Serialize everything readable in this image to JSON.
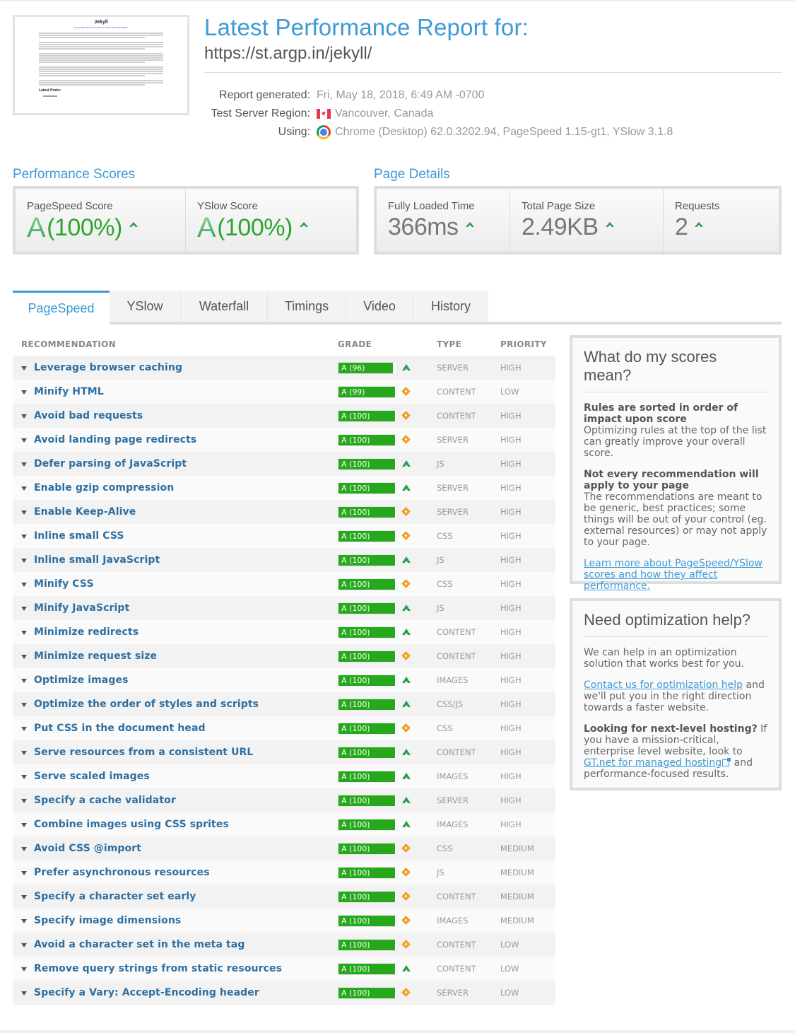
{
  "header": {
    "title": "Latest Performance Report for:",
    "url": "https://st.argp.in/jekyll/",
    "thumbnail": {
      "site_title": "Jekyll",
      "nav": "Home Blog Source Download Gem Documentation",
      "section": "Latest Posts:"
    },
    "meta": [
      {
        "label": "Report generated:",
        "value": "Fri, May 18, 2018, 6:49 AM -0700",
        "icon": ""
      },
      {
        "label": "Test Server Region:",
        "value": "Vancouver, Canada",
        "icon": "canada-flag-icon"
      },
      {
        "label": "Using:",
        "value": "Chrome (Desktop) 62.0.3202.94, PageSpeed 1.15-gt1, YSlow 3.1.8",
        "icon": "chrome-icon"
      }
    ]
  },
  "performance_scores": {
    "heading": "Performance Scores",
    "items": [
      {
        "label": "PageSpeed Score",
        "grade": "A",
        "percent": "(100%)",
        "trend": "up"
      },
      {
        "label": "YSlow Score",
        "grade": "A",
        "percent": "(100%)",
        "trend": "up"
      }
    ]
  },
  "page_details": {
    "heading": "Page Details",
    "items": [
      {
        "label": "Fully Loaded Time",
        "value": "366ms",
        "trend": "up"
      },
      {
        "label": "Total Page Size",
        "value": "2.49KB",
        "trend": "up"
      },
      {
        "label": "Requests",
        "value": "2",
        "trend": "up"
      }
    ]
  },
  "tabs": [
    {
      "label": "PageSpeed",
      "active": true
    },
    {
      "label": "YSlow",
      "active": false
    },
    {
      "label": "Waterfall",
      "active": false
    },
    {
      "label": "Timings",
      "active": false
    },
    {
      "label": "Video",
      "active": false
    },
    {
      "label": "History",
      "active": false
    }
  ],
  "table": {
    "columns": {
      "recommendation": "RECOMMENDATION",
      "grade": "GRADE",
      "type": "TYPE",
      "priority": "PRIORITY"
    },
    "rows": [
      {
        "name": "Leverage browser caching",
        "grade": "A (96)",
        "score": 96,
        "trend": "up",
        "type": "SERVER",
        "priority": "HIGH"
      },
      {
        "name": "Minify HTML",
        "grade": "A (99)",
        "score": 99,
        "trend": "neutral",
        "type": "CONTENT",
        "priority": "LOW"
      },
      {
        "name": "Avoid bad requests",
        "grade": "A (100)",
        "score": 100,
        "trend": "neutral",
        "type": "CONTENT",
        "priority": "HIGH"
      },
      {
        "name": "Avoid landing page redirects",
        "grade": "A (100)",
        "score": 100,
        "trend": "neutral",
        "type": "SERVER",
        "priority": "HIGH"
      },
      {
        "name": "Defer parsing of JavaScript",
        "grade": "A (100)",
        "score": 100,
        "trend": "up",
        "type": "JS",
        "priority": "HIGH"
      },
      {
        "name": "Enable gzip compression",
        "grade": "A (100)",
        "score": 100,
        "trend": "up",
        "type": "SERVER",
        "priority": "HIGH"
      },
      {
        "name": "Enable Keep-Alive",
        "grade": "A (100)",
        "score": 100,
        "trend": "neutral",
        "type": "SERVER",
        "priority": "HIGH"
      },
      {
        "name": "Inline small CSS",
        "grade": "A (100)",
        "score": 100,
        "trend": "neutral",
        "type": "CSS",
        "priority": "HIGH"
      },
      {
        "name": "Inline small JavaScript",
        "grade": "A (100)",
        "score": 100,
        "trend": "up",
        "type": "JS",
        "priority": "HIGH"
      },
      {
        "name": "Minify CSS",
        "grade": "A (100)",
        "score": 100,
        "trend": "neutral",
        "type": "CSS",
        "priority": "HIGH"
      },
      {
        "name": "Minify JavaScript",
        "grade": "A (100)",
        "score": 100,
        "trend": "up",
        "type": "JS",
        "priority": "HIGH"
      },
      {
        "name": "Minimize redirects",
        "grade": "A (100)",
        "score": 100,
        "trend": "up",
        "type": "CONTENT",
        "priority": "HIGH"
      },
      {
        "name": "Minimize request size",
        "grade": "A (100)",
        "score": 100,
        "trend": "neutral",
        "type": "CONTENT",
        "priority": "HIGH"
      },
      {
        "name": "Optimize images",
        "grade": "A (100)",
        "score": 100,
        "trend": "up",
        "type": "IMAGES",
        "priority": "HIGH"
      },
      {
        "name": "Optimize the order of styles and scripts",
        "grade": "A (100)",
        "score": 100,
        "trend": "up",
        "type": "CSS/JS",
        "priority": "HIGH"
      },
      {
        "name": "Put CSS in the document head",
        "grade": "A (100)",
        "score": 100,
        "trend": "neutral",
        "type": "CSS",
        "priority": "HIGH"
      },
      {
        "name": "Serve resources from a consistent URL",
        "grade": "A (100)",
        "score": 100,
        "trend": "up",
        "type": "CONTENT",
        "priority": "HIGH"
      },
      {
        "name": "Serve scaled images",
        "grade": "A (100)",
        "score": 100,
        "trend": "up",
        "type": "IMAGES",
        "priority": "HIGH"
      },
      {
        "name": "Specify a cache validator",
        "grade": "A (100)",
        "score": 100,
        "trend": "up",
        "type": "SERVER",
        "priority": "HIGH"
      },
      {
        "name": "Combine images using CSS sprites",
        "grade": "A (100)",
        "score": 100,
        "trend": "up",
        "type": "IMAGES",
        "priority": "HIGH"
      },
      {
        "name": "Avoid CSS @import",
        "grade": "A (100)",
        "score": 100,
        "trend": "neutral",
        "type": "CSS",
        "priority": "MEDIUM"
      },
      {
        "name": "Prefer asynchronous resources",
        "grade": "A (100)",
        "score": 100,
        "trend": "neutral",
        "type": "JS",
        "priority": "MEDIUM"
      },
      {
        "name": "Specify a character set early",
        "grade": "A (100)",
        "score": 100,
        "trend": "neutral",
        "type": "CONTENT",
        "priority": "MEDIUM"
      },
      {
        "name": "Specify image dimensions",
        "grade": "A (100)",
        "score": 100,
        "trend": "neutral",
        "type": "IMAGES",
        "priority": "MEDIUM"
      },
      {
        "name": "Avoid a character set in the meta tag",
        "grade": "A (100)",
        "score": 100,
        "trend": "neutral",
        "type": "CONTENT",
        "priority": "LOW"
      },
      {
        "name": "Remove query strings from static resources",
        "grade": "A (100)",
        "score": 100,
        "trend": "up",
        "type": "CONTENT",
        "priority": "LOW"
      },
      {
        "name": "Specify a Vary: Accept-Encoding header",
        "grade": "A (100)",
        "score": 100,
        "trend": "neutral",
        "type": "SERVER",
        "priority": "LOW"
      }
    ]
  },
  "scores_help": {
    "heading": "What do my scores mean?",
    "p1_bold": "Rules are sorted in order of impact upon score",
    "p1_text": "Optimizing rules at the top of the list can greatly improve your overall score.",
    "p2_bold": "Not every recommendation will apply to your page",
    "p2_text": "The recommendations are meant to be generic, best practices; some things will be out of your control (eg. external resources) or may not apply to your page.",
    "link": "Learn more about PageSpeed/YSlow scores and how they affect performance."
  },
  "optimization_help": {
    "heading": "Need optimization help?",
    "p1": "We can help in an optimization solution that works best for you.",
    "p2_link": "Contact us for optimization help",
    "p2_text": " and we'll put you in the right direction towards a faster website.",
    "p3_bold": "Looking for next-level hosting?",
    "p3_text": " If you have a mission-critical, enterprise level website, look to ",
    "p3_link": "GT.net for managed hosting",
    "p3_tail": " and performance-focused results."
  }
}
